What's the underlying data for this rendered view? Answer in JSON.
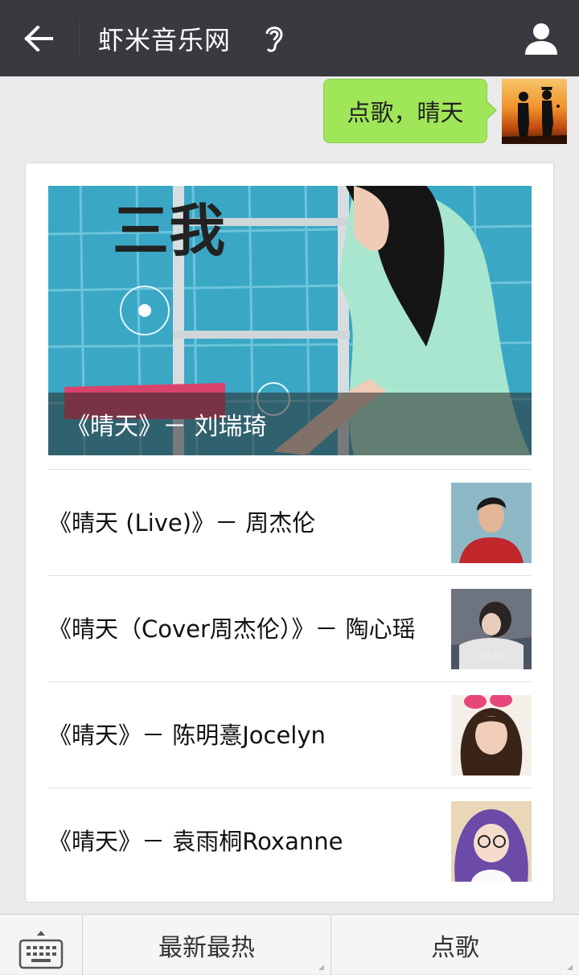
{
  "header": {
    "title": "虾米音乐网",
    "back_icon": "arrow-left-icon",
    "listen_icon": "ear-icon",
    "user_icon": "person-icon",
    "bg_color": "#393a3f"
  },
  "message": {
    "text": "点歌，晴天",
    "bubble_color": "#9fe658"
  },
  "card": {
    "featured": {
      "caption": "《晴天》－ 刘瑞琦",
      "art_text": "三我"
    },
    "items": [
      {
        "label": "《晴天 (Live)》－ 周杰伦"
      },
      {
        "label": "《晴天（Cover周杰伦）》－ 陶心瑶",
        "thumb_text": "FOR JAY"
      },
      {
        "label": "《晴天》－ 陈明憙Jocelyn"
      },
      {
        "label": "《晴天》－ 袁雨桐Roxanne"
      }
    ]
  },
  "bottom": {
    "keyboard_icon": "keyboard-icon",
    "menu1": "最新最热",
    "menu2": "点歌"
  }
}
